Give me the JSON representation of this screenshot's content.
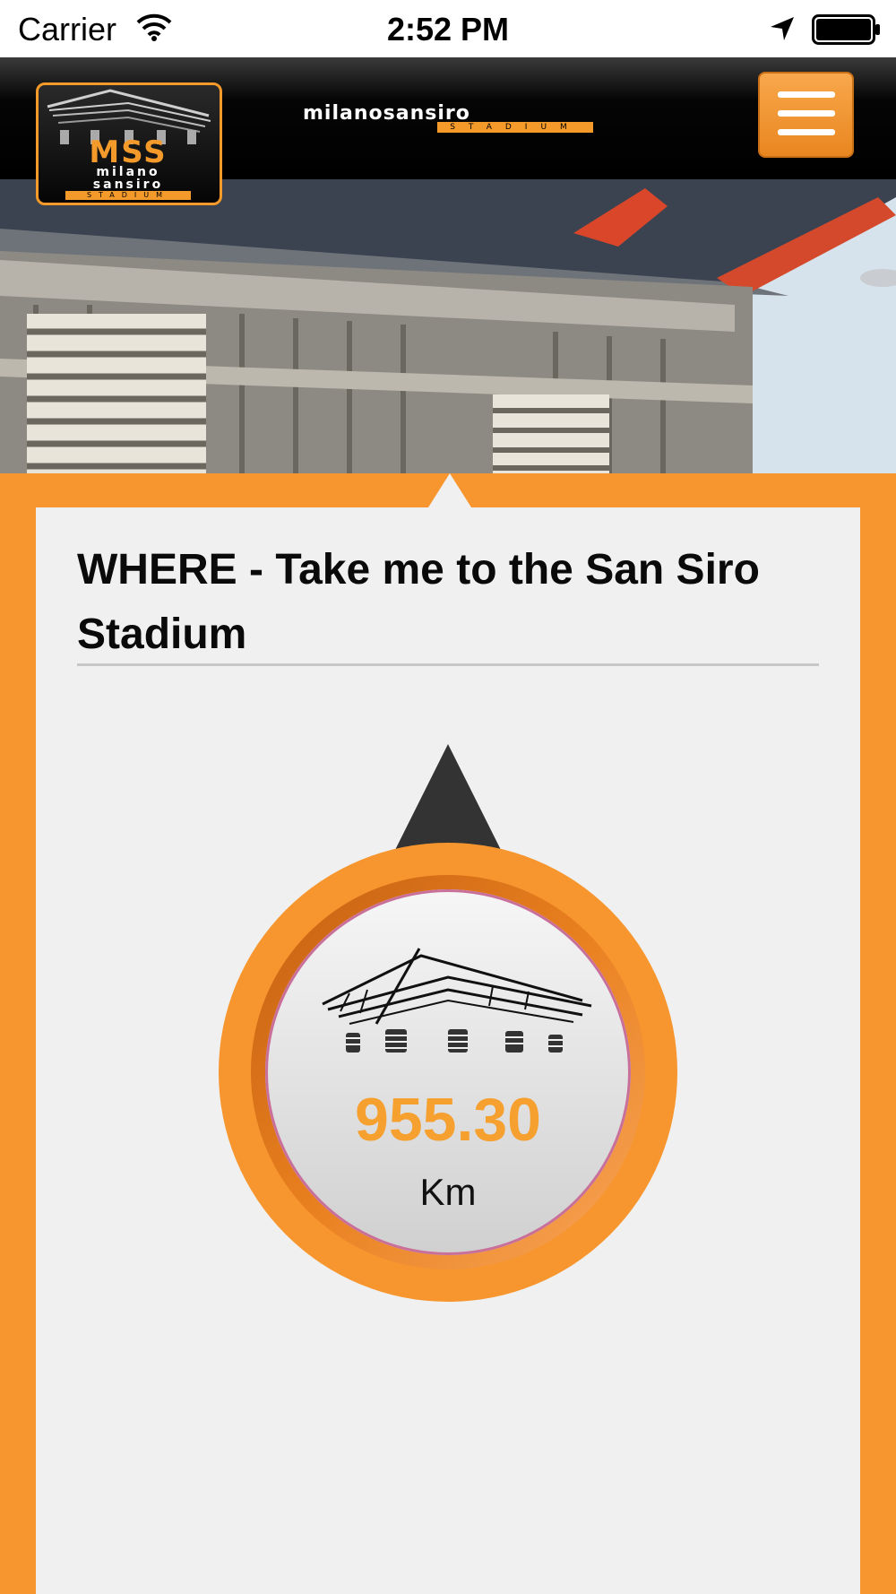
{
  "status_bar": {
    "carrier": "Carrier",
    "time": "2:52 PM",
    "icons": [
      "wifi-icon",
      "location-arrow-icon",
      "battery-icon"
    ]
  },
  "header": {
    "logo": {
      "initials": "MSS",
      "line1": "milano",
      "line2": "sansiro",
      "line3": "STADIUM"
    },
    "wordmark": {
      "text": "milanosansiro",
      "subtext": "STADIUM"
    },
    "menu_icon": "hamburger-menu-icon"
  },
  "hero": {
    "image": "san-siro-stadium-photo"
  },
  "content": {
    "title": "WHERE - Take me to the San Siro Stadium",
    "compass": {
      "distance": "955.30",
      "unit": "Km"
    }
  },
  "colors": {
    "accent_orange": "#f7952e",
    "distance_orange": "#f5a02f",
    "header_black": "#000000",
    "card_background": "#f0f0f0",
    "pointer_dark": "#333333"
  }
}
